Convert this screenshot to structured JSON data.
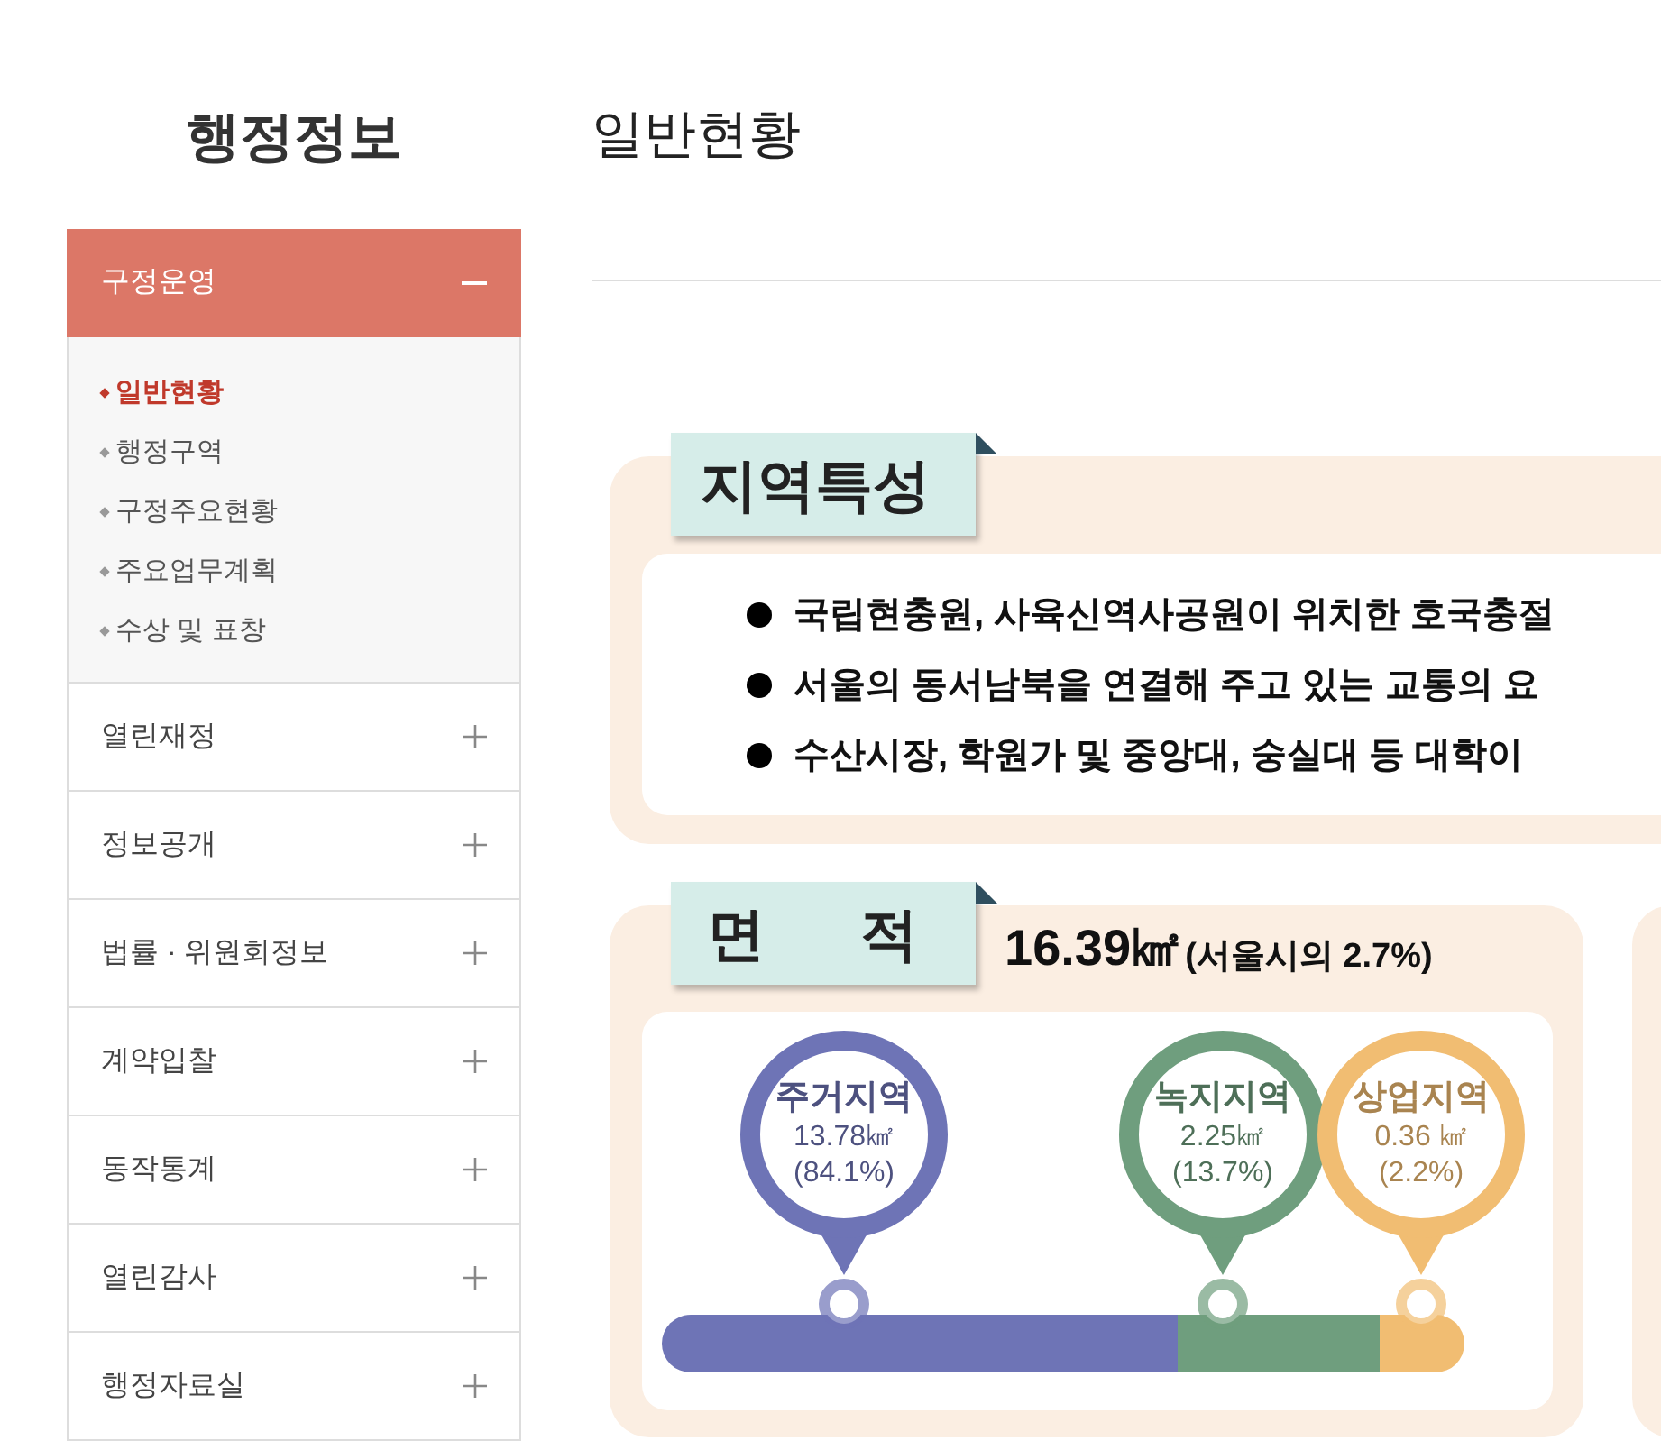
{
  "sidebar": {
    "title": "행정정보",
    "menu": [
      {
        "label": "구정운영",
        "expanded": true,
        "children": [
          {
            "label": "일반현황",
            "selected": true
          },
          {
            "label": "행정구역",
            "selected": false
          },
          {
            "label": "구정주요현황",
            "selected": false
          },
          {
            "label": "주요업무계획",
            "selected": false
          },
          {
            "label": "수상 및 표창",
            "selected": false
          }
        ]
      },
      {
        "label": "열린재정",
        "expanded": false
      },
      {
        "label": "정보공개",
        "expanded": false
      },
      {
        "label": "법률 · 위원회정보",
        "expanded": false
      },
      {
        "label": "계약입찰",
        "expanded": false
      },
      {
        "label": "동작통계",
        "expanded": false
      },
      {
        "label": "열린감사",
        "expanded": false
      },
      {
        "label": "행정자료실",
        "expanded": false
      }
    ]
  },
  "page": {
    "title": "일반현황"
  },
  "features": {
    "tag": "지역특성",
    "bullets": [
      "국립현충원, 사육신역사공원이 위치한 호국충절",
      "서울의 동서남북을 연결해 주고 있는 교통의 요",
      "수산시장, 학원가 및 중앙대, 숭실대 등 대학이"
    ]
  },
  "area": {
    "tag": "면 적",
    "total": "16.39㎢",
    "share": "(서울시의 2.7%)",
    "zones": [
      {
        "name": "주거지역",
        "size": "13.78㎢",
        "percent": "(84.1%)",
        "color": "#6e74b6"
      },
      {
        "name": "녹지지역",
        "size": "2.25㎢",
        "percent": "(13.7%)",
        "color": "#6f9e7e"
      },
      {
        "name": "상업지역",
        "size": "0.36 ㎢",
        "percent": "(2.2%)",
        "color": "#f1bd72"
      }
    ]
  }
}
